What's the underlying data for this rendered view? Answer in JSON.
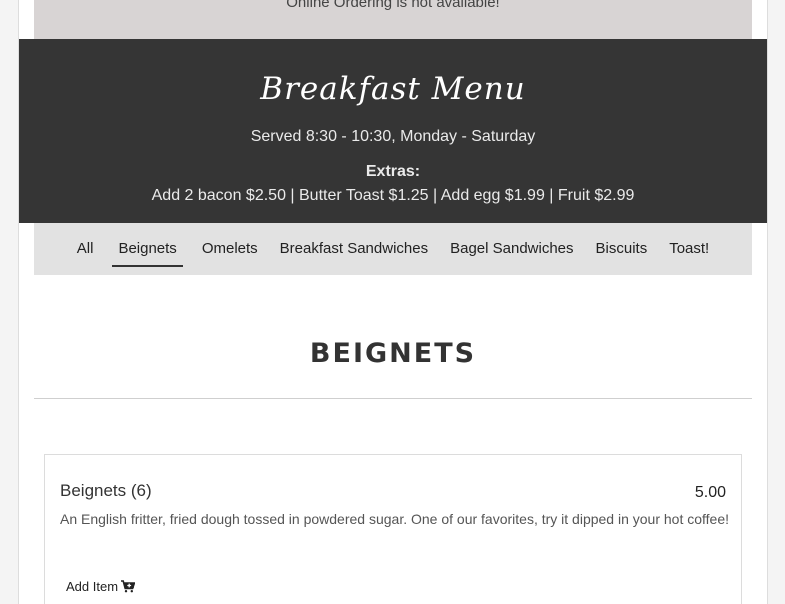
{
  "notice": {
    "text": "Online Ordering is not available!"
  },
  "hero": {
    "title": "Breakfast Menu",
    "hours": "Served 8:30 - 10:30, Monday - Saturday",
    "extras_label": "Extras:",
    "extras": "Add 2 bacon $2.50 | Butter Toast $1.25 | Add egg $1.99 | Fruit $2.99"
  },
  "tabs": [
    {
      "label": "All"
    },
    {
      "label": "Beignets"
    },
    {
      "label": "Omelets"
    },
    {
      "label": "Breakfast Sandwiches"
    },
    {
      "label": "Bagel Sandwiches"
    },
    {
      "label": "Biscuits"
    },
    {
      "label": "Toast!"
    }
  ],
  "active_tab": "Beignets",
  "section": {
    "title": "BEIGNETS"
  },
  "items": [
    {
      "name": "Beignets (6)",
      "price": "5.00",
      "description": "An English fritter, fried dough tossed in powdered sugar. One of our favorites, try it dipped in your hot coffee!",
      "add_label": "Add Item",
      "add_icon": "cart-plus-icon"
    }
  ]
}
